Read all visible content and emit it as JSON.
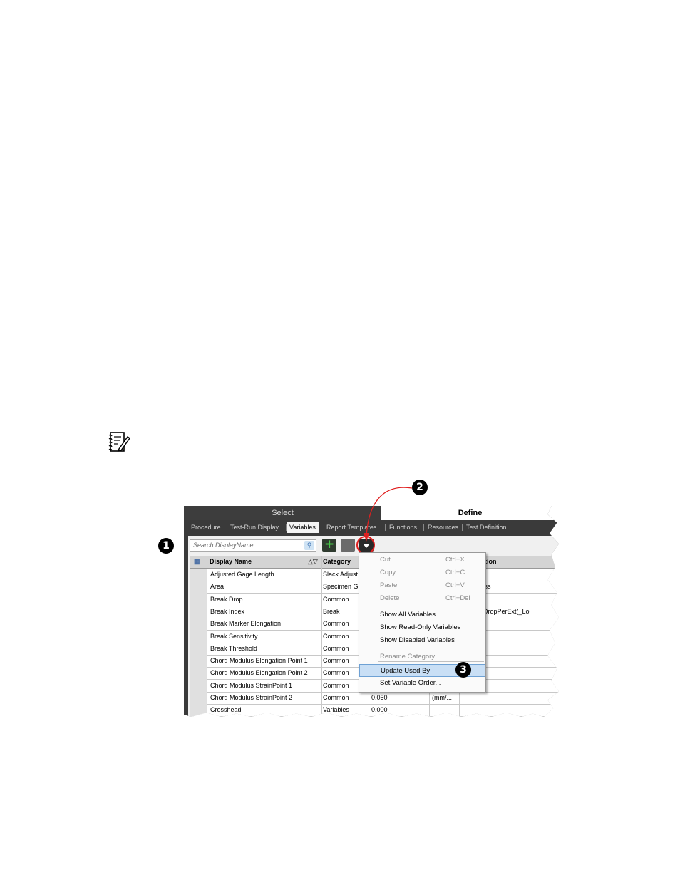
{
  "callouts": {
    "one": "1",
    "two": "2",
    "three": "3"
  },
  "app": {
    "top_segments": {
      "select": "Select",
      "define": "Define"
    },
    "tabs": [
      "Procedure",
      "Test-Run Display",
      "Variables",
      "Report Templates",
      "Functions",
      "Resources",
      "Test Definition"
    ],
    "active_tab": "Variables",
    "search": {
      "placeholder": "Search DisplayName..."
    },
    "grid": {
      "columns": {
        "display_name": "Display Name",
        "category": "Category",
        "tail": "tion"
      },
      "rows": [
        {
          "name": "Adjusted Gage Length",
          "category": "Slack Adjust",
          "value": "",
          "unit": "",
          "tail": "ength"
        },
        {
          "name": "Area",
          "category": "Specimen G",
          "value": "",
          "unit": "",
          "tail": "Thickness"
        },
        {
          "name": "Break Drop",
          "category": "Common",
          "value": "",
          "unit": "",
          "tail": ""
        },
        {
          "name": "Break Index",
          "category": "Break",
          "value": "",
          "unit": "",
          "tail": "ndexByDropPerExt(_Lo"
        },
        {
          "name": "Break Marker Elongation",
          "category": "Common",
          "value": "",
          "unit": "",
          "tail": ""
        },
        {
          "name": "Break Sensitivity",
          "category": "Common",
          "value": "",
          "unit": "",
          "tail": ""
        },
        {
          "name": "Break Threshold",
          "category": "Common",
          "value": "",
          "unit": "",
          "tail": ""
        },
        {
          "name": "Chord Modulus Elongation Point 1",
          "category": "Common",
          "value": "",
          "unit": "",
          "tail": ""
        },
        {
          "name": "Chord Modulus Elongation Point 2",
          "category": "Common",
          "value": "",
          "unit": "",
          "tail": ""
        },
        {
          "name": "Chord Modulus StrainPoint 1",
          "category": "Common",
          "value": "",
          "unit": "",
          "tail": ""
        },
        {
          "name": "Chord Modulus StrainPoint 2",
          "category": "Common",
          "value": "0.050",
          "unit": "(mm/...",
          "tail": ""
        },
        {
          "name": "Crosshead",
          "category": "Variables",
          "value": "0.000",
          "unit": "",
          "tail": ""
        }
      ]
    },
    "context_menu": [
      {
        "label": "Cut",
        "key": "Ctrl+X",
        "disabled": true
      },
      {
        "label": "Copy",
        "key": "Ctrl+C",
        "disabled": true
      },
      {
        "label": "Paste",
        "key": "Ctrl+V",
        "disabled": true
      },
      {
        "label": "Delete",
        "key": "Ctrl+Del",
        "disabled": true
      },
      {
        "label": "Show All Variables",
        "key": "",
        "disabled": false
      },
      {
        "label": "Show Read-Only Variables",
        "key": "",
        "disabled": false
      },
      {
        "label": "Show Disabled Variables",
        "key": "",
        "disabled": false
      },
      {
        "label": "Rename Category...",
        "key": "",
        "disabled": true
      },
      {
        "label": "Update Used By",
        "key": "",
        "disabled": false,
        "highlighted": true
      },
      {
        "label": "Set Variable Order...",
        "key": "",
        "disabled": false
      }
    ]
  },
  "colors": {
    "callout_arrow": "#e02020",
    "menu_highlight": "#c9dff5"
  }
}
